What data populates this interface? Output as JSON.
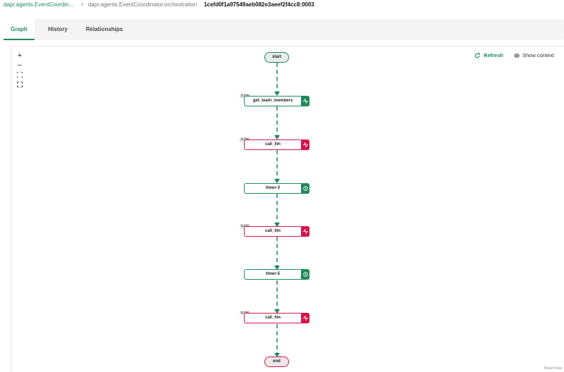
{
  "breadcrumb": {
    "root": "dapr.agents.EventCoordin...",
    "separator": ">",
    "workflow": "dapr.agents.EventCoordinator.orchestration",
    "instance_id": "1cefd0f1a97549aeb082e3aeef2f4cc8:0003"
  },
  "tabs": [
    {
      "label": "Graph",
      "active": true
    },
    {
      "label": "History",
      "active": false
    },
    {
      "label": "Relationships",
      "active": false
    }
  ],
  "controls": {
    "zoom_in": "+",
    "zoom_out": "−",
    "fit_view": "⛶",
    "fullscreen": "⛶"
  },
  "toolbar": {
    "refresh_label": "Refresh",
    "show_context_label": "Show context"
  },
  "graph": {
    "start_label": "start",
    "end_label": "end",
    "steps": [
      {
        "label": "get_team_members",
        "duration": "3.73s",
        "status": "green",
        "icon": "activity-icon"
      },
      {
        "label": "call_llm",
        "duration": "6.79s",
        "status": "red",
        "icon": "activity-icon"
      },
      {
        "label": "timer-3",
        "duration": "",
        "status": "green",
        "icon": "clock-icon"
      },
      {
        "label": "call_llm",
        "duration": "5.27s",
        "status": "red",
        "icon": "activity-icon"
      },
      {
        "label": "timer-5",
        "duration": "",
        "status": "green",
        "icon": "clock-icon"
      },
      {
        "label": "call_llm",
        "duration": "6.18s",
        "status": "red",
        "icon": "activity-icon"
      }
    ]
  },
  "colors": {
    "accent": "#1f8a5b",
    "error": "#d4164b",
    "edge": "#1f8a5b"
  },
  "watermark": "React Flow"
}
